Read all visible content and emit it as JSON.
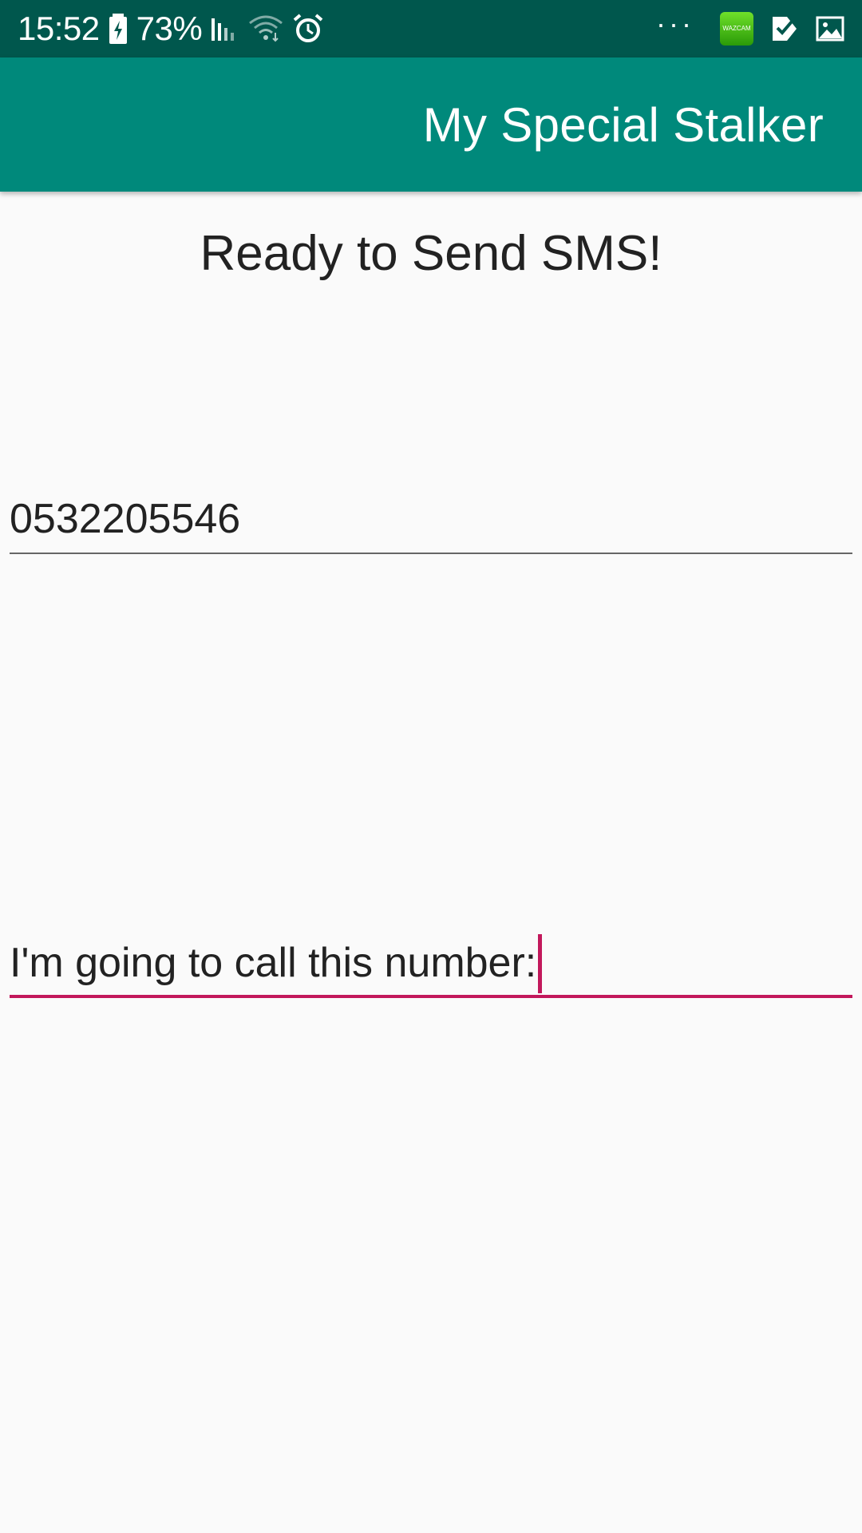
{
  "status_bar": {
    "time": "15:52",
    "battery_percent": "73%",
    "wazcam_label": "WAZCAM",
    "icons": [
      "battery-charging-icon",
      "signal-icon",
      "wifi-icon",
      "alarm-icon",
      "more-dots-icon",
      "wazcam-app-icon",
      "checklist-icon",
      "image-icon"
    ]
  },
  "app_bar": {
    "title": "My Special Stalker"
  },
  "main": {
    "heading": "Ready to Send SMS!",
    "phone_field": {
      "value": "0532205546"
    },
    "message_field": {
      "value": "I'm going to call this number:"
    }
  },
  "colors": {
    "status_bar": "#00574d",
    "app_bar": "#00897b",
    "accent": "#c2185b",
    "background": "#fafafa"
  }
}
